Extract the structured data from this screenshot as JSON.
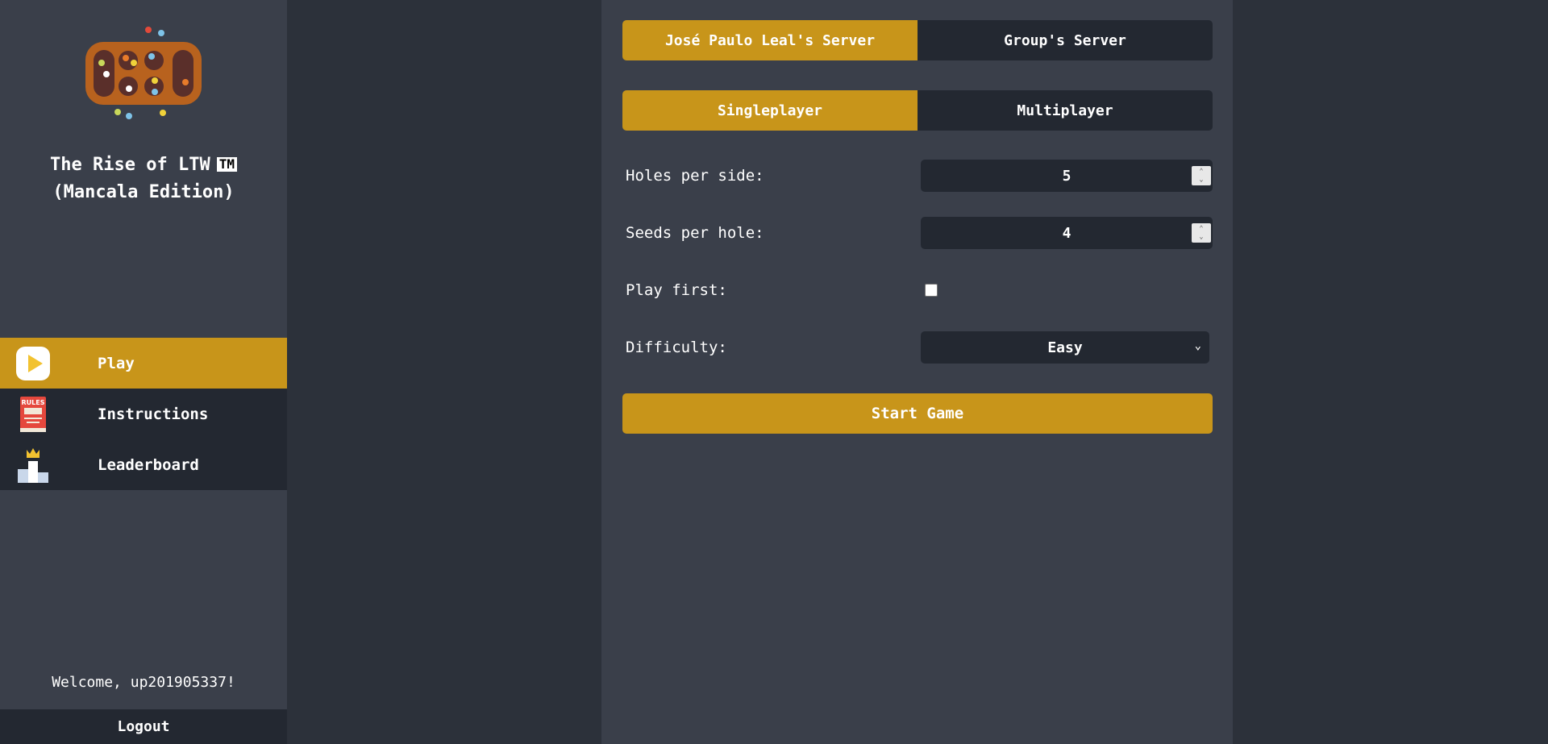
{
  "sidebar": {
    "app_title_line1": "The Rise of LTW",
    "app_title_tm": "TM",
    "app_title_line2": "(Mancala Edition)",
    "nav": [
      {
        "label": "Play",
        "icon": "play-icon",
        "active": true
      },
      {
        "label": "Instructions",
        "icon": "rules-book-icon",
        "active": false
      },
      {
        "label": "Leaderboard",
        "icon": "podium-crown-icon",
        "active": false
      }
    ],
    "rules_icon_text": "RULES",
    "welcome": "Welcome, up201905337!",
    "logout_label": "Logout"
  },
  "main": {
    "server_tabs": [
      {
        "label": "José Paulo Leal's Server",
        "active": true
      },
      {
        "label": "Group's Server",
        "active": false
      }
    ],
    "mode_tabs": [
      {
        "label": "Singleplayer",
        "active": true
      },
      {
        "label": "Multiplayer",
        "active": false
      }
    ],
    "holes_label": "Holes per side:",
    "holes_value": "5",
    "seeds_label": "Seeds per hole:",
    "seeds_value": "4",
    "play_first_label": "Play first:",
    "play_first_checked": false,
    "difficulty_label": "Difficulty:",
    "difficulty_value": "Easy",
    "start_label": "Start Game"
  },
  "colors": {
    "accent": "#c8951a",
    "dark": "#232831",
    "panel": "#3a3f4a",
    "background": "#2c313a"
  }
}
